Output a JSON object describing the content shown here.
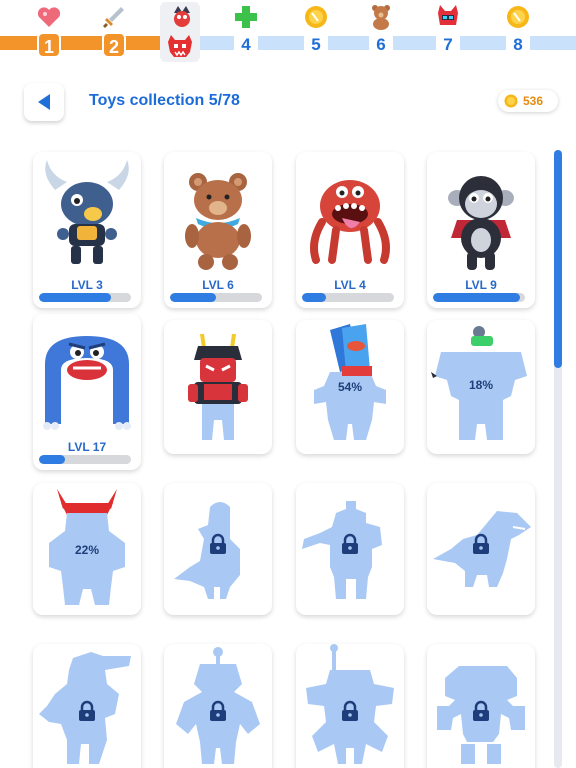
{
  "progress": {
    "steps": [
      {
        "label": "1",
        "state": "done",
        "icon": "heart-icon"
      },
      {
        "label": "2",
        "state": "done",
        "icon": "sword-icon"
      },
      {
        "label": "",
        "state": "current",
        "icon": "red-monster-icon"
      },
      {
        "label": "4",
        "state": "todo",
        "icon": "green-cross-icon"
      },
      {
        "label": "5",
        "state": "todo",
        "icon": "coin-icon"
      },
      {
        "label": "6",
        "state": "todo",
        "icon": "teddy-bear-icon"
      },
      {
        "label": "7",
        "state": "todo",
        "icon": "red-robot-icon"
      },
      {
        "label": "8",
        "state": "todo",
        "icon": "coin-icon"
      }
    ]
  },
  "header": {
    "back_icon": "back-arrow-icon",
    "title": "Toys collection 5/78",
    "coins": "536"
  },
  "colors": {
    "accent": "#1b6bd8",
    "progress_done": "#f2942a",
    "silhouette": "#a9c9f4",
    "bar_fill": "#2f7de2"
  },
  "toys": [
    {
      "name": "horned-bull-toy",
      "status": "owned",
      "level_label": "LVL 3",
      "level_progress": 0.78
    },
    {
      "name": "teddy-bear-toy",
      "status": "owned",
      "level_label": "LVL 6",
      "level_progress": 0.5
    },
    {
      "name": "red-crab-monster-toy",
      "status": "owned",
      "level_label": "LVL 4",
      "level_progress": 0.26
    },
    {
      "name": "vampire-monkey-toy",
      "status": "owned",
      "level_label": "LVL 9",
      "level_progress": 0.95
    },
    {
      "name": "blue-arch-monster-toy",
      "status": "owned",
      "level_label": "LVL 17",
      "level_progress": 0.28
    },
    {
      "name": "samurai-robot-toy",
      "status": "partial"
    },
    {
      "name": "card-robot-toy",
      "status": "partial",
      "progress_label": "54%"
    },
    {
      "name": "mech-pilot-toy",
      "status": "partial",
      "progress_label": "18%"
    },
    {
      "name": "horned-robot-toy",
      "status": "partial",
      "progress_label": "22%"
    },
    {
      "name": "bird-toy",
      "status": "locked"
    },
    {
      "name": "gunner-robot-toy",
      "status": "locked"
    },
    {
      "name": "dinosaur-toy",
      "status": "locked"
    },
    {
      "name": "crocodile-toy",
      "status": "locked"
    },
    {
      "name": "antenna-robot-toy",
      "status": "locked"
    },
    {
      "name": "walker-mech-toy",
      "status": "locked"
    },
    {
      "name": "block-golem-toy",
      "status": "locked"
    }
  ]
}
